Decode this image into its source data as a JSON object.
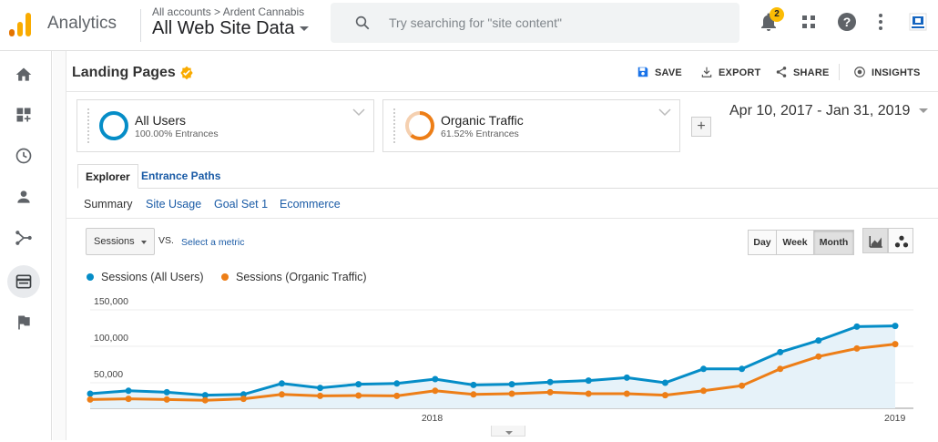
{
  "app": {
    "name": "Analytics"
  },
  "account": {
    "breadcrumb": "All accounts > Ardent Cannabis",
    "view": "All Web Site Data"
  },
  "search": {
    "placeholder": "Try searching for \"site content\""
  },
  "toolbar": {
    "notifications": {
      "count": "2",
      "icon": "bell-icon"
    },
    "apps_icon": "apps-grid-icon",
    "help_icon": "help-icon",
    "menu_icon": "more-vert-icon",
    "account_icon": "account-logo-icon"
  },
  "sidebar": {
    "items": [
      {
        "icon": "home-icon"
      },
      {
        "icon": "customization-icon"
      },
      {
        "icon": "realtime-clock-icon"
      },
      {
        "icon": "audience-person-icon"
      },
      {
        "icon": "acquisition-icon"
      },
      {
        "icon": "behavior-icon",
        "active": true
      },
      {
        "icon": "conversions-flag-icon"
      }
    ]
  },
  "page": {
    "title": "Landing Pages"
  },
  "actions": {
    "save": "SAVE",
    "export": "EXPORT",
    "share": "SHARE",
    "insights": "INSIGHTS"
  },
  "segments": [
    {
      "name": "All Users",
      "sub": "100.00% Entrances",
      "color": "#058dc7"
    },
    {
      "name": "Organic Traffic",
      "sub": "61.52% Entrances",
      "color": "#ed7e17"
    }
  ],
  "daterange": "Apr 10, 2017 - Jan 31, 2019",
  "tabs": {
    "explorer": "Explorer",
    "entrance_paths": "Entrance Paths"
  },
  "subtabs": {
    "summary": "Summary",
    "site_usage": "Site Usage",
    "goal_set": "Goal Set 1",
    "ecommerce": "Ecommerce"
  },
  "metric": {
    "selected": "Sessions",
    "vs": "VS.",
    "select_metric": "Select a metric"
  },
  "granularity": {
    "day": "Day",
    "week": "Week",
    "month": "Month",
    "active": "Month"
  },
  "chart_data": {
    "type": "line",
    "series": [
      {
        "name": "Sessions (All Users)",
        "color": "#058dc7",
        "values": [
          20000,
          24000,
          22000,
          18000,
          19000,
          34000,
          28000,
          33000,
          34000,
          40000,
          32000,
          33000,
          36000,
          38000,
          42000,
          35000,
          54000,
          54000,
          77000,
          93000,
          112000,
          113000
        ]
      },
      {
        "name": "Sessions (Organic Traffic)",
        "color": "#ed7e17",
        "values": [
          12000,
          13000,
          12000,
          11000,
          13000,
          19000,
          17000,
          17500,
          17000,
          24000,
          19000,
          20000,
          22000,
          20000,
          20000,
          18000,
          24000,
          31000,
          54000,
          71000,
          82000,
          88000
        ]
      }
    ],
    "x": [
      "2017-04",
      "2017-05",
      "2017-06",
      "2017-07",
      "2017-08",
      "2017-09",
      "2017-10",
      "2017-11",
      "2017-12",
      "2018-01",
      "2018-02",
      "2018-03",
      "2018-04",
      "2018-05",
      "2018-06",
      "2018-07",
      "2018-08",
      "2018-09",
      "2018-10",
      "2018-11",
      "2018-12",
      "2019-01"
    ],
    "x_ticks": [
      "2018",
      "2019"
    ],
    "y_ticks": [
      "150,000",
      "100,000",
      "50,000"
    ],
    "ylim": [
      0,
      150000
    ],
    "grid": true,
    "legend": "top-left"
  }
}
